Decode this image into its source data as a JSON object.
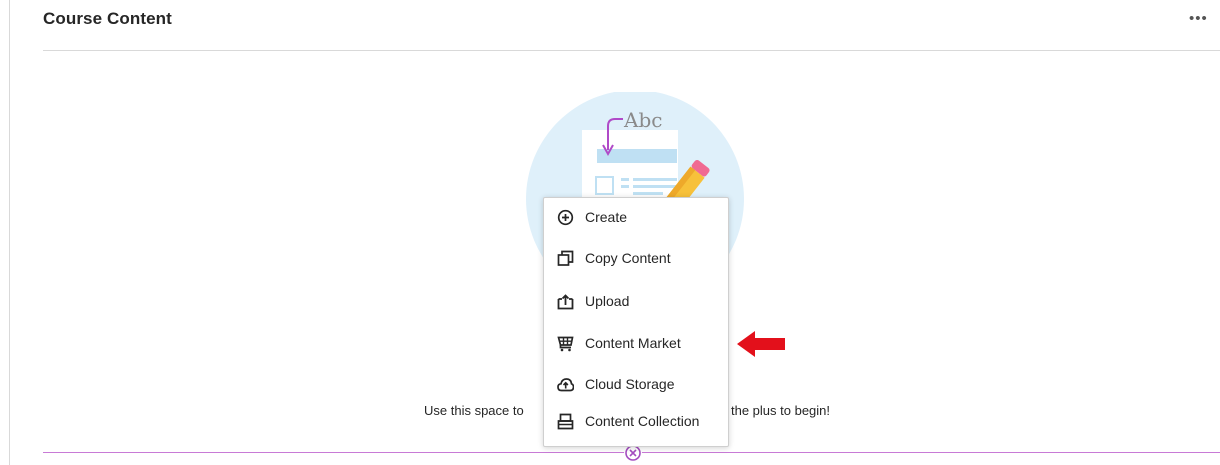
{
  "header": {
    "title": "Course Content",
    "more_label": "•••"
  },
  "illustration": {
    "text": "Abc"
  },
  "empty_state": {
    "text_left": "Use this space to",
    "text_right": "the plus to begin!"
  },
  "menu": {
    "items": [
      {
        "label": "Create",
        "icon": "plus-circle-icon"
      },
      {
        "label": "Copy Content",
        "icon": "copy-icon"
      },
      {
        "label": "Upload",
        "icon": "upload-icon"
      },
      {
        "label": "Content Market",
        "icon": "cart-icon"
      },
      {
        "label": "Cloud Storage",
        "icon": "cloud-upload-icon"
      },
      {
        "label": "Content Collection",
        "icon": "collection-icon"
      }
    ]
  },
  "colors": {
    "accent": "#c87ad6",
    "annotation_arrow": "#e3101b"
  }
}
